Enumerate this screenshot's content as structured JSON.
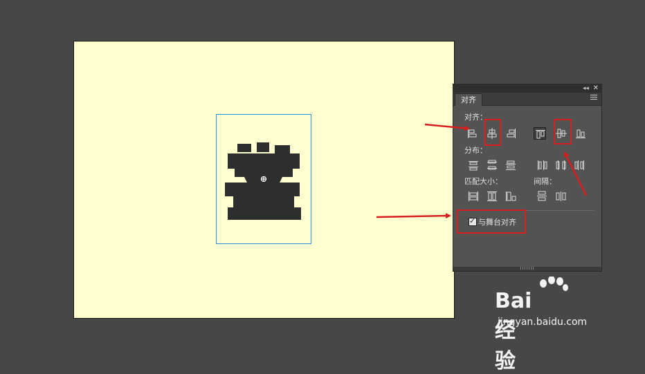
{
  "panel": {
    "tab_label": "对齐",
    "align_label": "对齐：",
    "distribute_label": "分布：",
    "match_size_label": "匹配大小：",
    "spacing_label": "间隔：",
    "stage_align_label": "与舞台对齐",
    "stage_align_checked": true
  },
  "watermark": {
    "brand": "Bai  经验",
    "url": "jingyan.baidu.com"
  },
  "colors": {
    "stage": "#ffffd0",
    "selection": "#2a8ee0",
    "highlight": "#d81f1f",
    "panel": "#535353"
  }
}
